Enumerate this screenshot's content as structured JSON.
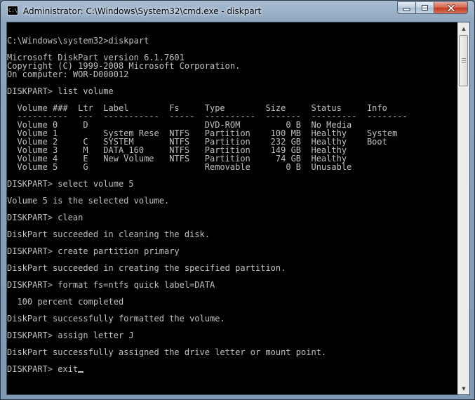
{
  "window": {
    "title": "Administrator: C:\\Windows\\System32\\cmd.exe - diskpart",
    "app_icon_text": "C:\\",
    "controls": {
      "minimize_icon": "minimize-icon",
      "maximize_icon": "maximize-icon",
      "close_icon": "close-icon"
    }
  },
  "console": {
    "lines": [
      "",
      "C:\\Windows\\system32>diskpart",
      "",
      "Microsoft DiskPart version 6.1.7601",
      "Copyright (C) 1999-2008 Microsoft Corporation.",
      "On computer: WOR-D000012",
      "",
      "DISKPART> list volume",
      "",
      "  Volume ###  Ltr  Label        Fs     Type        Size     Status     Info",
      "  ----------  ---  -----------  -----  ----------  -------  ---------  --------",
      "  Volume 0     D                       DVD-ROM         0 B  No Media",
      "  Volume 1         System Rese  NTFS   Partition    100 MB  Healthy    System",
      "  Volume 2     C   SYSTEM       NTFS   Partition    232 GB  Healthy    Boot",
      "  Volume 3     M   DATA_160     NTFS   Partition    149 GB  Healthy",
      "  Volume 4     E   New Volume   NTFS   Partition     74 GB  Healthy",
      "  Volume 5     G                       Removable       0 B  Unusable",
      "",
      "DISKPART> select volume 5",
      "",
      "Volume 5 is the selected volume.",
      "",
      "DISKPART> clean",
      "",
      "DiskPart succeeded in cleaning the disk.",
      "",
      "DISKPART> create partition primary",
      "",
      "DiskPart succeeded in creating the specified partition.",
      "",
      "DISKPART> format fs=ntfs quick label=DATA",
      "",
      "  100 percent completed",
      "",
      "DiskPart successfully formatted the volume.",
      "",
      "DISKPART> assign letter J",
      "",
      "DiskPart successfully assigned the drive letter or mount point.",
      "",
      "DISKPART> exit"
    ]
  },
  "scrollbar": {
    "up_icon": "scroll-up-arrow-icon",
    "down_icon": "scroll-down-arrow-icon"
  }
}
